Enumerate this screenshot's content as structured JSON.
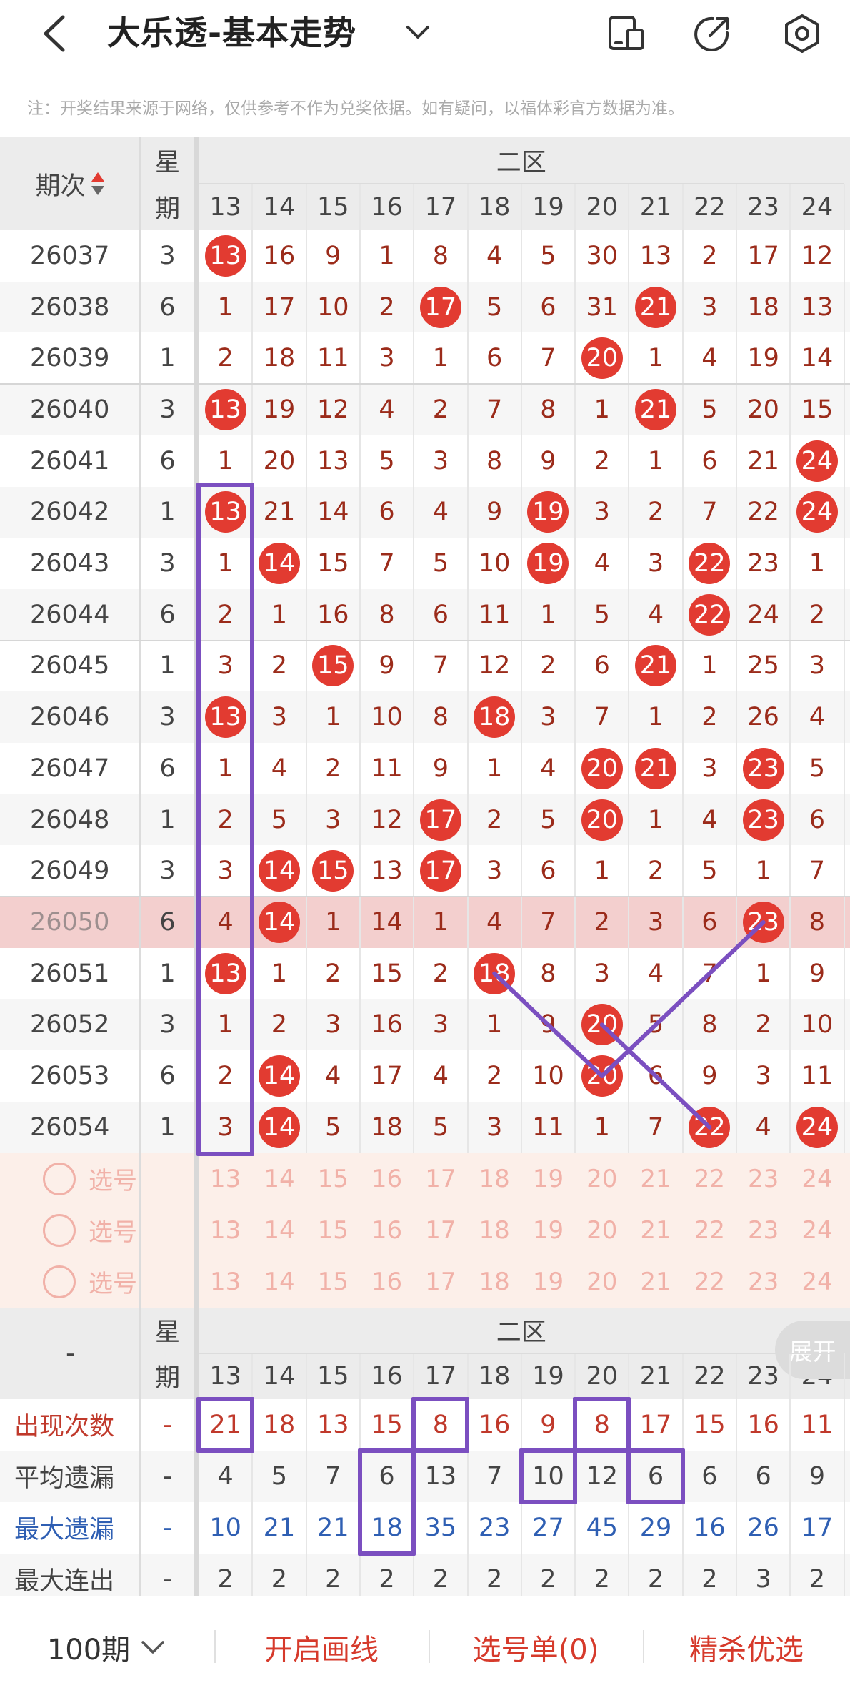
{
  "header": {
    "title": "大乐透-基本走势",
    "notice": "注：开奖结果来源于网络，仅供参考不作为兑奖依据。如有疑问，以福体彩官方数据为准。"
  },
  "table": {
    "col_period": "期次",
    "col_week": [
      "星",
      "期"
    ],
    "zone": "二区",
    "numbers": [
      "13",
      "14",
      "15",
      "16",
      "17",
      "18",
      "19",
      "20",
      "21",
      "22",
      "23",
      "24"
    ],
    "rows": [
      {
        "period": "26037",
        "week": "3",
        "cells": [
          "13",
          "16",
          "9",
          "1",
          "8",
          "4",
          "5",
          "30",
          "13",
          "2",
          "17",
          "12"
        ],
        "hits": [
          0
        ]
      },
      {
        "period": "26038",
        "week": "6",
        "cells": [
          "1",
          "17",
          "10",
          "2",
          "17",
          "5",
          "6",
          "31",
          "21",
          "3",
          "18",
          "13"
        ],
        "hits": [
          4,
          8
        ]
      },
      {
        "period": "26039",
        "week": "1",
        "cells": [
          "2",
          "18",
          "11",
          "3",
          "1",
          "6",
          "7",
          "20",
          "1",
          "4",
          "19",
          "14"
        ],
        "hits": [
          7
        ]
      },
      {
        "period": "26040",
        "week": "3",
        "cells": [
          "13",
          "19",
          "12",
          "4",
          "2",
          "7",
          "8",
          "1",
          "21",
          "5",
          "20",
          "15"
        ],
        "hits": [
          0,
          8
        ]
      },
      {
        "period": "26041",
        "week": "6",
        "cells": [
          "1",
          "20",
          "13",
          "5",
          "3",
          "8",
          "9",
          "2",
          "1",
          "6",
          "21",
          "24"
        ],
        "hits": [
          11
        ]
      },
      {
        "period": "26042",
        "week": "1",
        "cells": [
          "13",
          "21",
          "14",
          "6",
          "4",
          "9",
          "19",
          "3",
          "2",
          "7",
          "22",
          "24"
        ],
        "hits": [
          0,
          6,
          11
        ]
      },
      {
        "period": "26043",
        "week": "3",
        "cells": [
          "1",
          "14",
          "15",
          "7",
          "5",
          "10",
          "19",
          "4",
          "3",
          "22",
          "23",
          "1"
        ],
        "hits": [
          1,
          6,
          9
        ]
      },
      {
        "period": "26044",
        "week": "6",
        "cells": [
          "2",
          "1",
          "16",
          "8",
          "6",
          "11",
          "1",
          "5",
          "4",
          "22",
          "24",
          "2"
        ],
        "hits": [
          9
        ]
      },
      {
        "period": "26045",
        "week": "1",
        "cells": [
          "3",
          "2",
          "15",
          "9",
          "7",
          "12",
          "2",
          "6",
          "21",
          "1",
          "25",
          "3"
        ],
        "hits": [
          2,
          8
        ]
      },
      {
        "period": "26046",
        "week": "3",
        "cells": [
          "13",
          "3",
          "1",
          "10",
          "8",
          "18",
          "3",
          "7",
          "1",
          "2",
          "26",
          "4"
        ],
        "hits": [
          0,
          5
        ]
      },
      {
        "period": "26047",
        "week": "6",
        "cells": [
          "1",
          "4",
          "2",
          "11",
          "9",
          "1",
          "4",
          "20",
          "21",
          "3",
          "23",
          "5"
        ],
        "hits": [
          7,
          8,
          10
        ]
      },
      {
        "period": "26048",
        "week": "1",
        "cells": [
          "2",
          "5",
          "3",
          "12",
          "17",
          "2",
          "5",
          "20",
          "1",
          "4",
          "23",
          "6"
        ],
        "hits": [
          4,
          7,
          10
        ]
      },
      {
        "period": "26049",
        "week": "3",
        "cells": [
          "3",
          "14",
          "15",
          "13",
          "17",
          "3",
          "6",
          "1",
          "2",
          "5",
          "1",
          "7"
        ],
        "hits": [
          1,
          2,
          4
        ]
      },
      {
        "period": "26050",
        "week": "6",
        "cells": [
          "4",
          "14",
          "1",
          "14",
          "1",
          "4",
          "7",
          "2",
          "3",
          "6",
          "23",
          "8"
        ],
        "hits": [
          1,
          10
        ],
        "highlight": true
      },
      {
        "period": "26051",
        "week": "1",
        "cells": [
          "13",
          "1",
          "2",
          "15",
          "2",
          "18",
          "8",
          "3",
          "4",
          "7",
          "1",
          "9"
        ],
        "hits": [
          0,
          5
        ]
      },
      {
        "period": "26052",
        "week": "3",
        "cells": [
          "1",
          "2",
          "3",
          "16",
          "3",
          "1",
          "9",
          "20",
          "5",
          "8",
          "2",
          "10"
        ],
        "hits": [
          7
        ]
      },
      {
        "period": "26053",
        "week": "6",
        "cells": [
          "2",
          "14",
          "4",
          "17",
          "4",
          "2",
          "10",
          "20",
          "6",
          "9",
          "3",
          "11"
        ],
        "hits": [
          1,
          7
        ]
      },
      {
        "period": "26054",
        "week": "1",
        "cells": [
          "3",
          "14",
          "5",
          "18",
          "5",
          "3",
          "11",
          "1",
          "7",
          "22",
          "4",
          "24"
        ],
        "hits": [
          1,
          9,
          11
        ]
      }
    ],
    "pick_label": "选号",
    "stats_dash": "-",
    "expand": "展开",
    "stats": [
      {
        "label": "出现次数",
        "color": "#c0392b",
        "values": [
          "21",
          "18",
          "13",
          "15",
          "8",
          "16",
          "9",
          "8",
          "17",
          "15",
          "16",
          "11"
        ]
      },
      {
        "label": "平均遗漏",
        "color": "#444444",
        "values": [
          "4",
          "5",
          "7",
          "6",
          "13",
          "7",
          "10",
          "12",
          "6",
          "6",
          "6",
          "9"
        ]
      },
      {
        "label": "最大遗漏",
        "color": "#2f5fb3",
        "values": [
          "10",
          "21",
          "21",
          "18",
          "35",
          "23",
          "27",
          "45",
          "29",
          "16",
          "26",
          "17"
        ]
      },
      {
        "label": "最大连出",
        "color": "#444444",
        "values": [
          "2",
          "2",
          "2",
          "2",
          "2",
          "2",
          "2",
          "2",
          "2",
          "2",
          "3",
          "2"
        ]
      }
    ]
  },
  "bottom": {
    "periods": "100期",
    "draw": "开启画线",
    "picklist": "选号单(0)",
    "premium": "精杀优选"
  },
  "colors": {
    "ball": "#e23b31",
    "accent": "#d63a2b",
    "annotation": "#7b4fc0"
  }
}
